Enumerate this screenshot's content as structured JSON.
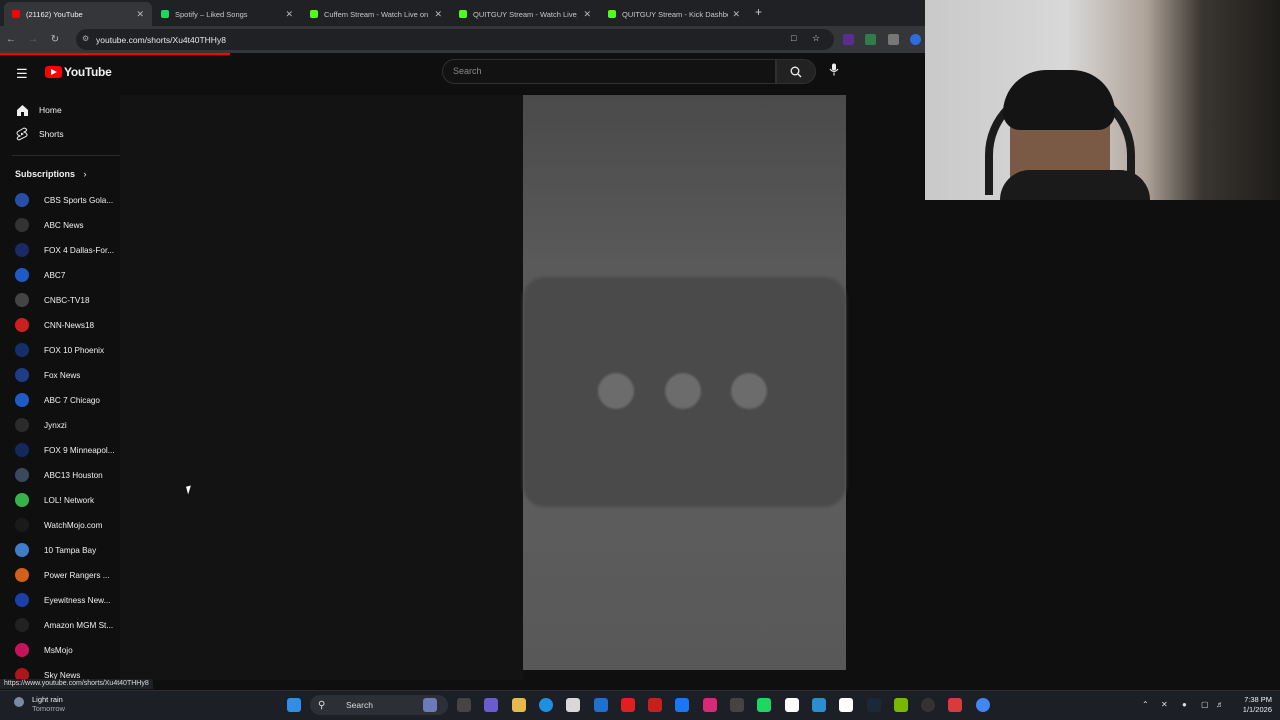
{
  "tabs": [
    {
      "title": "(21162) YouTube",
      "color": "#ff0000",
      "active": true
    },
    {
      "title": "Spotify – Liked Songs",
      "color": "#1ed760"
    },
    {
      "title": "Cuffem Stream - Watch Live on",
      "color": "#53fc18"
    },
    {
      "title": "QUITGUY Stream - Watch Live on",
      "color": "#53fc18"
    },
    {
      "title": "QUITGUY Stream - Kick Dashboard",
      "color": "#53fc18"
    }
  ],
  "address": {
    "url": "youtube.com/shorts/Xu4t40THHy8"
  },
  "youtube": {
    "logo": "YouTube",
    "search_placeholder": "Search",
    "nav": [
      {
        "label": "Home",
        "icon": "home-icon"
      },
      {
        "label": "Shorts",
        "icon": "shorts-icon"
      }
    ],
    "subscriptions_title": "Subscriptions",
    "subscriptions": [
      {
        "name": "CBS Sports Gola...",
        "color": "#2a4da8"
      },
      {
        "name": "ABC News",
        "color": "#333333"
      },
      {
        "name": "FOX 4 Dallas-For...",
        "color": "#1a2a66"
      },
      {
        "name": "ABC7",
        "color": "#1e5bc6"
      },
      {
        "name": "CNBC-TV18",
        "color": "#444444"
      },
      {
        "name": "CNN-News18",
        "color": "#cc1f1f"
      },
      {
        "name": "FOX 10 Phoenix",
        "color": "#14306b"
      },
      {
        "name": "Fox News",
        "color": "#1f3c88"
      },
      {
        "name": "ABC 7 Chicago",
        "color": "#1e5bc6"
      },
      {
        "name": "Jynxzi",
        "color": "#2b2b2b"
      },
      {
        "name": "FOX 9 Minneapol...",
        "color": "#13285c"
      },
      {
        "name": "ABC13 Houston",
        "color": "#3a4a5e"
      },
      {
        "name": "LOL! Network",
        "color": "#35b34a"
      },
      {
        "name": "WatchMojo.com",
        "color": "#1a1a1a"
      },
      {
        "name": "10 Tampa Bay",
        "color": "#3f7dc9"
      },
      {
        "name": "Power Rangers ...",
        "color": "#d2601a"
      },
      {
        "name": "Eyewitness New...",
        "color": "#1e3fa8"
      },
      {
        "name": "Amazon MGM St...",
        "color": "#222222"
      },
      {
        "name": "MsMojo",
        "color": "#c4155c"
      },
      {
        "name": "Sky News",
        "color": "#b0151b"
      }
    ]
  },
  "status_url": "https://www.youtube.com/shorts/Xu4t40THHy8",
  "taskbar": {
    "weather_line1": "Light rain",
    "weather_line2": "Tomorrow",
    "search_label": "Search",
    "time": "7:38 PM",
    "date": "1/1/2026"
  }
}
